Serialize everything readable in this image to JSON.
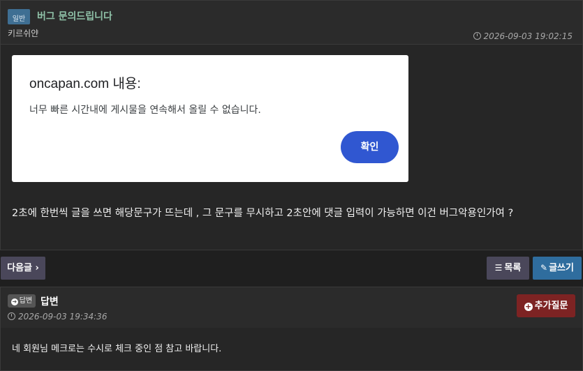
{
  "post": {
    "category": "일반",
    "title": "버그 문의드립니다",
    "author": "키르쉬얀",
    "date": "2026-09-03 19:02:15",
    "dialog": {
      "title": "oncapan.com 내용:",
      "message": "너무 빠른 시간내에 게시물을 연속해서 올릴 수 없습니다.",
      "ok_label": "확인"
    },
    "body": "2초에 한번씩 글을 쓰면 해당문구가 뜨는데 , 그 문구를 무시하고 2초안에 댓글 입력이 가능하면 이건 버그악용인가여 ?"
  },
  "nav": {
    "next_label": "다음글",
    "next_chevron": "›",
    "list_label": "목록",
    "list_icon": "☰",
    "write_label": "글쓰기",
    "write_icon": "✎"
  },
  "answer": {
    "badge_label": "답변",
    "badge_icon": "➜",
    "title": "답변",
    "date": "2026-09-03 19:34:36",
    "followup_label": "추가질문",
    "followup_icon": "+",
    "text": "네 회원님 메크로는 수시로 체크 중인 점 참고 바랍니다."
  }
}
